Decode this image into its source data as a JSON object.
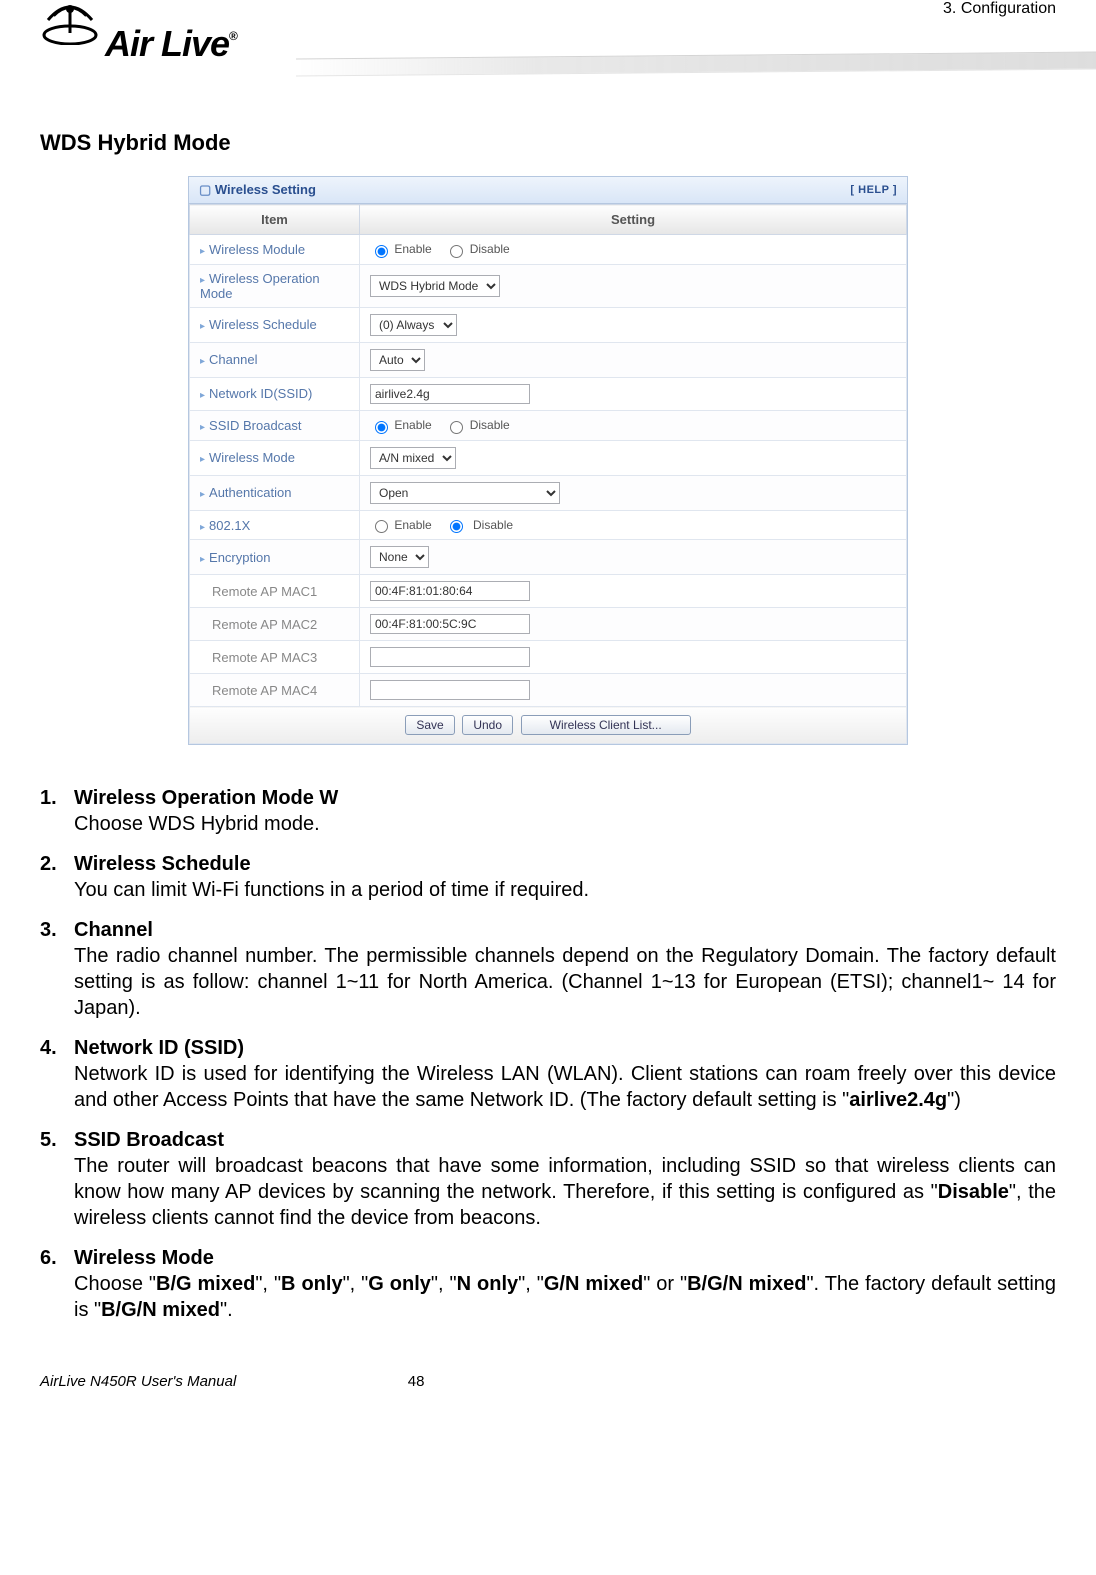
{
  "header": {
    "logo_text": "Air Live",
    "reg": "®",
    "right": "3. Configuration"
  },
  "section_title": "WDS Hybrid Mode",
  "panel": {
    "title_icon": "▫",
    "title": "Wireless Setting",
    "help": "[ HELP ]",
    "col_item": "Item",
    "col_setting": "Setting",
    "rows": {
      "wireless_module": {
        "label": "Wireless Module",
        "enable": "Enable",
        "disable": "Disable"
      },
      "op_mode": {
        "label": "Wireless Operation Mode",
        "value": "WDS Hybrid Mode"
      },
      "schedule": {
        "label": "Wireless Schedule",
        "value": "(0) Always"
      },
      "channel": {
        "label": "Channel",
        "value": "Auto"
      },
      "ssid": {
        "label": "Network ID(SSID)",
        "value": "airlive2.4g"
      },
      "ssid_bcast": {
        "label": "SSID Broadcast",
        "enable": "Enable",
        "disable": "Disable"
      },
      "wmode": {
        "label": "Wireless Mode",
        "value": "A/N mixed"
      },
      "auth": {
        "label": "Authentication",
        "value": "Open"
      },
      "dot1x": {
        "label": "802.1X",
        "enable": "Enable",
        "disable": "Disable"
      },
      "encryption": {
        "label": "Encryption",
        "value": "None"
      },
      "mac1": {
        "label": "Remote AP MAC1",
        "value": "00:4F:81:01:80:64"
      },
      "mac2": {
        "label": "Remote AP MAC2",
        "value": "00:4F:81:00:5C:9C"
      },
      "mac3": {
        "label": "Remote AP MAC3",
        "value": ""
      },
      "mac4": {
        "label": "Remote AP MAC4",
        "value": ""
      }
    },
    "buttons": {
      "save": "Save",
      "undo": "Undo",
      "clients": "Wireless Client List..."
    }
  },
  "body_items": [
    {
      "num": "1.",
      "title": "Wireless Operation Mode W",
      "text": "Choose WDS Hybrid mode."
    },
    {
      "num": "2.",
      "title": "Wireless Schedule",
      "text": "You can limit Wi-Fi functions in a period of time if required."
    },
    {
      "num": "3.",
      "title": "Channel",
      "text": "The radio channel number. The permissible channels depend on the Regulatory Domain. The factory default setting is as follow: channel 1~11 for North America. (Channel 1~13 for European (ETSI); channel1~ 14 for Japan)."
    },
    {
      "num": "4.",
      "title": "Network ID (SSID)",
      "text_pre": "Network ID is used for identifying the Wireless LAN (WLAN). Client stations can roam freely over this device and other Access Points that have the same Network ID. (The factory default setting is \"",
      "bold1": "airlive2.4g",
      "text_post": "\")"
    },
    {
      "num": "5.",
      "title": "SSID Broadcast",
      "text_pre": "The router will broadcast beacons that have some information, including SSID so that wireless clients can know how many AP devices by scanning the network. Therefore, if this setting is configured as \"",
      "bold1": "Disable",
      "text_post": "\", the wireless clients cannot find the device from beacons."
    },
    {
      "num": "6.",
      "title": "Wireless Mode",
      "segments": [
        {
          "t": "Choose \"",
          "b": false
        },
        {
          "t": "B/G mixed",
          "b": true
        },
        {
          "t": "\", \"",
          "b": false
        },
        {
          "t": "B only",
          "b": true
        },
        {
          "t": "\", \"",
          "b": false
        },
        {
          "t": "G only",
          "b": true
        },
        {
          "t": "\", \"",
          "b": false
        },
        {
          "t": "N only",
          "b": true
        },
        {
          "t": "\", \"",
          "b": false
        },
        {
          "t": "G/N mixed",
          "b": true
        },
        {
          "t": "\" or \"",
          "b": false
        },
        {
          "t": "B/G/N mixed",
          "b": true
        },
        {
          "t": "\". The factory default setting is \"",
          "b": false
        },
        {
          "t": "B/G/N mixed",
          "b": true
        },
        {
          "t": "\".",
          "b": false
        }
      ]
    }
  ],
  "footer": {
    "left": "AirLive N450R User's Manual",
    "page": "48"
  }
}
